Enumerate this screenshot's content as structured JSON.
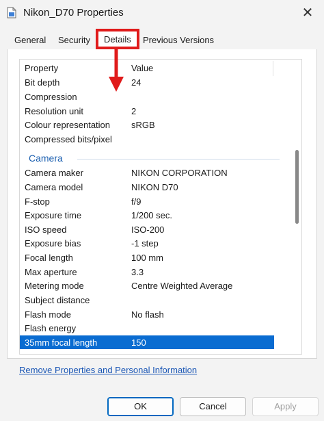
{
  "window": {
    "title": "Nikon_D70 Properties",
    "close_glyph": "✕"
  },
  "tabs": [
    {
      "label": "General"
    },
    {
      "label": "Security"
    },
    {
      "label": "Details"
    },
    {
      "label": "Previous Versions"
    }
  ],
  "details": {
    "header": {
      "property": "Property",
      "value": "Value"
    },
    "image_rows": [
      {
        "k": "Bit depth",
        "v": "24"
      },
      {
        "k": "Compression",
        "v": ""
      },
      {
        "k": "Resolution unit",
        "v": "2"
      },
      {
        "k": "Colour representation",
        "v": "sRGB"
      },
      {
        "k": "Compressed bits/pixel",
        "v": ""
      }
    ],
    "camera_section": "Camera",
    "camera_rows": [
      {
        "k": "Camera maker",
        "v": "NIKON CORPORATION"
      },
      {
        "k": "Camera model",
        "v": "NIKON D70"
      },
      {
        "k": "F-stop",
        "v": "f/9"
      },
      {
        "k": "Exposure time",
        "v": "1/200 sec."
      },
      {
        "k": "ISO speed",
        "v": "ISO-200"
      },
      {
        "k": "Exposure bias",
        "v": "-1 step"
      },
      {
        "k": "Focal length",
        "v": "100 mm"
      },
      {
        "k": "Max aperture",
        "v": "3.3"
      },
      {
        "k": "Metering mode",
        "v": "Centre Weighted Average"
      },
      {
        "k": "Subject distance",
        "v": ""
      },
      {
        "k": "Flash mode",
        "v": "No flash"
      },
      {
        "k": "Flash energy",
        "v": ""
      },
      {
        "k": "35mm focal length",
        "v": "150"
      }
    ]
  },
  "link": "Remove Properties and Personal Information",
  "buttons": {
    "ok": "OK",
    "cancel": "Cancel",
    "apply": "Apply"
  },
  "colors": {
    "highlight": "#e01b1b",
    "selection": "#0a6cd1",
    "link": "#1a56b5"
  }
}
